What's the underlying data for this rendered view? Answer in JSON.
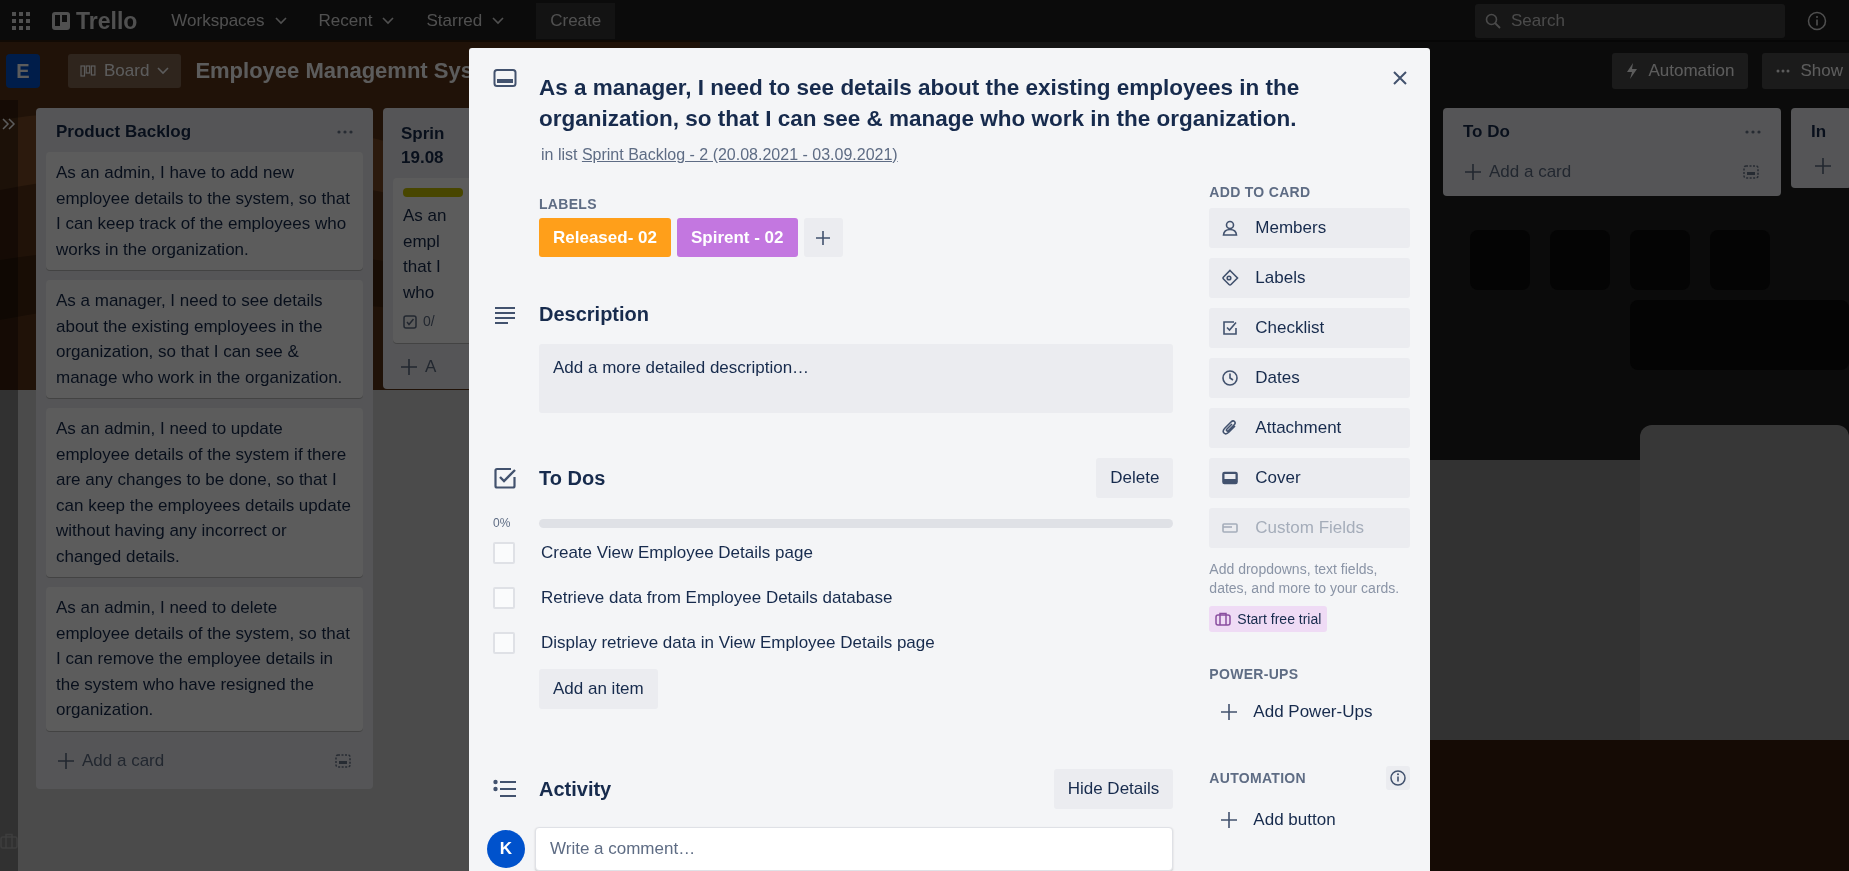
{
  "top_bar": {
    "logo": "Trello",
    "menus": [
      {
        "label": "Workspaces"
      },
      {
        "label": "Recent"
      },
      {
        "label": "Starred"
      }
    ],
    "create": "Create",
    "search": {
      "placeholder": "Search"
    }
  },
  "board_header": {
    "workspace_initial": "E",
    "view": "Board",
    "title": "Employee Managemnt Sys",
    "automation": "Automation",
    "show": "Show"
  },
  "product_backlog": {
    "title": "Product Backlog",
    "cards": [
      {
        "text": "As an admin, I have to add new employee details to the system, so that I can keep track of the employees who works in the organization."
      },
      {
        "text": "As a manager, I need to see details about the existing employees in the organization, so that I can see & manage who work in the organization."
      },
      {
        "text": "As an admin, I need to update employee details of the system if there are any changes to be done, so that I can keep the employees details update without having any incorrect or changed details."
      },
      {
        "text": "As an admin, I need to delete employee details of the system, so that I can remove the employee details in the system who have resigned the organization."
      }
    ],
    "add_card": "Add a card"
  },
  "sprint_list": {
    "title_lines": [
      "Sprin",
      "19.08"
    ],
    "card_lines": [
      "As an",
      "empl",
      "that I",
      "who"
    ],
    "checklist_badge": "0/",
    "add_card": "A"
  },
  "todo_list": {
    "title": "To Do",
    "add_card": "Add a card"
  },
  "in_list": {
    "title": "In"
  },
  "card_modal": {
    "title": "As a manager, I need to see details about the existing employees in the organization, so that I can see & manage who work in the organization.",
    "in_list_prefix": "in list",
    "list_link": "Sprint Backlog - 2 (20.08.2021 - 03.09.2021)",
    "labels_heading": "LABELS",
    "labels": [
      {
        "text": "Released- 02",
        "color": "#ff9f1a"
      },
      {
        "text": "Spirent - 02",
        "color": "#c377e0"
      }
    ],
    "description": {
      "title": "Description",
      "placeholder": "Add a more detailed description…"
    },
    "checklist": {
      "title": "To Dos",
      "delete": "Delete",
      "percent": "0%",
      "level": 0,
      "items": [
        {
          "text": "Create View Employee Details page",
          "checked": false
        },
        {
          "text": "Retrieve data from Employee Details database",
          "checked": false
        },
        {
          "text": "Display retrieve data in View Employee Details page",
          "checked": false
        }
      ],
      "add_item": "Add an item"
    },
    "activity": {
      "title": "Activity",
      "hide_details": "Hide Details",
      "avatar": "K",
      "comment_placeholder": "Write a comment…"
    },
    "sidebar": {
      "add_heading": "ADD TO CARD",
      "buttons": [
        {
          "kind": "members",
          "label": "Members",
          "disabled": false
        },
        {
          "kind": "labels",
          "label": "Labels",
          "disabled": false
        },
        {
          "kind": "checklist",
          "label": "Checklist",
          "disabled": false
        },
        {
          "kind": "dates",
          "label": "Dates",
          "disabled": false
        },
        {
          "kind": "attachment",
          "label": "Attachment",
          "disabled": false
        },
        {
          "kind": "cover",
          "label": "Cover",
          "disabled": false
        },
        {
          "kind": "fields",
          "label": "Custom Fields",
          "disabled": true
        }
      ],
      "upsell": "Add dropdowns, text fields, dates, and more to your cards.",
      "trial": "Start free trial",
      "powerups_heading": "POWER-UPS",
      "add_powerups": "Add Power-Ups",
      "automation_heading": "AUTOMATION",
      "add_button": "Add button"
    }
  }
}
